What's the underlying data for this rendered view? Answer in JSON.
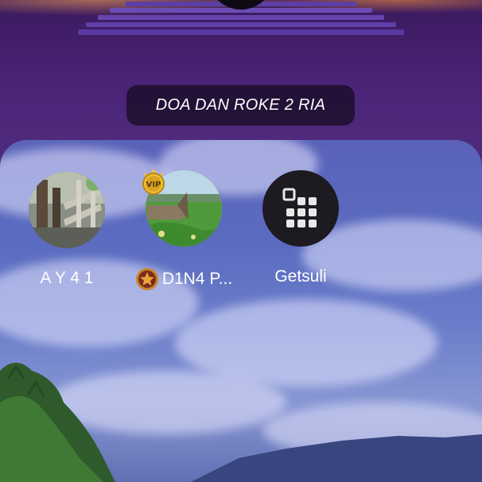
{
  "room": {
    "title": "DOA DAN ROKE 2 RIA"
  },
  "seats": [
    {
      "name": "A Y 4 1",
      "avatar": "photo-wooden-fence-avatar"
    },
    {
      "name": "D1N4 P...",
      "avatar": "photo-green-field-avatar",
      "badge": "VIP",
      "medal_icon": "star-medal-icon"
    },
    {
      "name": "Getsuli",
      "avatar": "grid-dots-icon"
    }
  ],
  "colors": {
    "background": "#4a2a78",
    "pill": "#1c0e28",
    "avatar_dark": "#1e1a22",
    "vip_gold": "#f2c230"
  }
}
